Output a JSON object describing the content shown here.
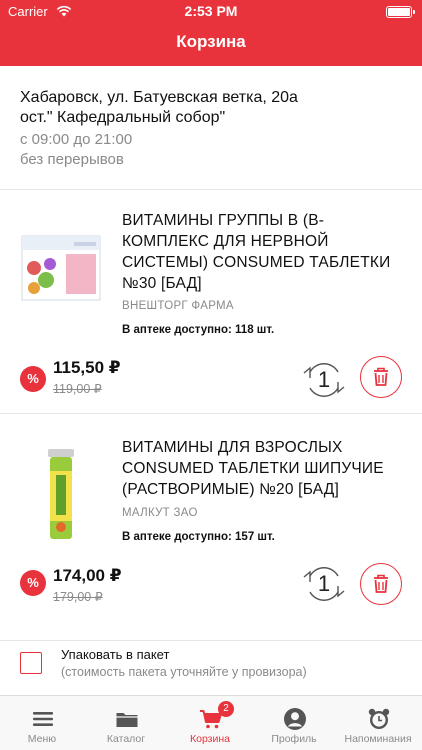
{
  "status": {
    "carrier": "Carrier",
    "time": "2:53 PM"
  },
  "header": {
    "title": "Корзина"
  },
  "store": {
    "address_line1": "Хабаровск, ул. Батуевская ветка, 20а",
    "address_line2": "ост.\" Кафедральный собор\"",
    "hours": "с 09:00 до 21:00",
    "break": "без перерывов"
  },
  "items": [
    {
      "name": "ВИТАМИНЫ ГРУППЫ В (В-КОМПЛЕКС ДЛЯ НЕРВНОЙ СИСТЕМЫ) CONSUMED ТАБЛЕТКИ №30 [БАД]",
      "maker": "ВНЕШТОРГ ФАРМА",
      "stock": "В аптеке доступно: 118 шт.",
      "discount_icon": "%",
      "price": "115,50 ₽",
      "old_price": "119,00 ₽",
      "qty": "1"
    },
    {
      "name": "ВИТАМИНЫ ДЛЯ ВЗРОСЛЫХ CONSUMED ТАБЛЕТКИ ШИПУЧИЕ (РАСТВОРИМЫЕ) №20 [БАД]",
      "maker": "МАЛКУТ ЗАО",
      "stock": "В аптеке доступно: 157 шт.",
      "discount_icon": "%",
      "price": "174,00 ₽",
      "old_price": "179,00 ₽",
      "qty": "1"
    }
  ],
  "pack": {
    "label": "Упаковать в пакет",
    "note": "(стоимость пакета уточняйте у провизора)",
    "checked": false
  },
  "tabs": [
    {
      "label": "Меню",
      "icon": "menu-icon"
    },
    {
      "label": "Каталог",
      "icon": "folder-icon"
    },
    {
      "label": "Корзина",
      "icon": "cart-icon",
      "badge": "2",
      "active": true
    },
    {
      "label": "Профиль",
      "icon": "profile-icon"
    },
    {
      "label": "Напоминания",
      "icon": "alarm-clock-icon"
    }
  ],
  "colors": {
    "accent": "#e8333c",
    "muted": "#8a8a8a",
    "tab_bg": "#f8f8f8"
  }
}
